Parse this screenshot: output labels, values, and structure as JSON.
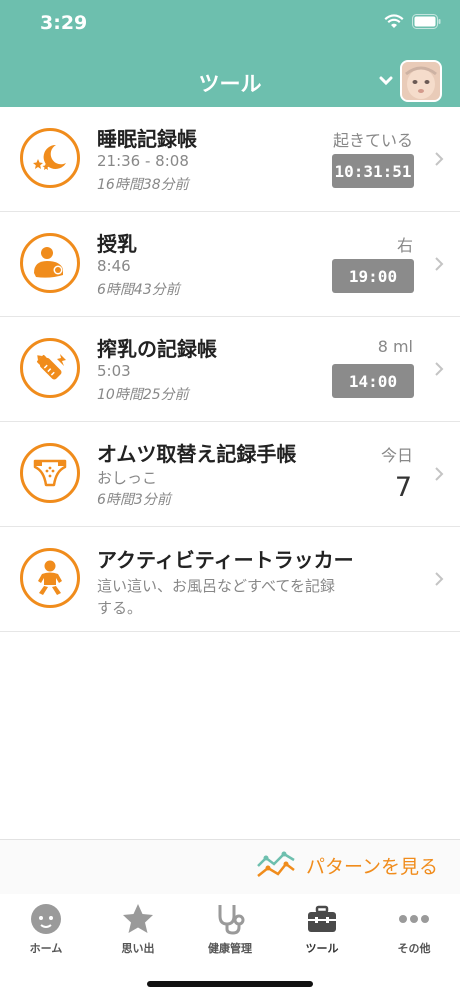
{
  "status": {
    "time": "3:29"
  },
  "header": {
    "title": "ツール"
  },
  "rows": [
    {
      "title": "睡眠記録帳",
      "sub1": "21:36 - 8:08",
      "sub2": "16時間38分前",
      "right_label": "起きている",
      "right_value": "10:31:51"
    },
    {
      "title": "授乳",
      "sub1": "8:46",
      "sub2": "6時間43分前",
      "right_label": "右",
      "right_value": "19:00"
    },
    {
      "title": "搾乳の記録帳",
      "sub1": "5:03",
      "sub2": "10時間25分前",
      "right_label": "8 ml",
      "right_value": "14:00"
    },
    {
      "title": "オムツ取替え記録手帳",
      "sub1": "おしっこ",
      "sub2": "6時間3分前",
      "right_label": "今日",
      "right_value": "7"
    },
    {
      "title": "アクティビティートラッカー",
      "desc": "這い這い、お風呂などすべてを記録する。"
    }
  ],
  "pattern": {
    "label": "パターンを見る"
  },
  "tabs": [
    {
      "label": "ホーム",
      "icon": "baby-face-icon"
    },
    {
      "label": "思い出",
      "icon": "star-icon"
    },
    {
      "label": "健康管理",
      "icon": "stethoscope-icon"
    },
    {
      "label": "ツール",
      "icon": "toolbox-icon"
    },
    {
      "label": "その他",
      "icon": "more-dots-icon"
    }
  ],
  "colors": {
    "header": "#6dbfae",
    "accent": "#f08c1c",
    "badge": "#8b8b8b"
  }
}
